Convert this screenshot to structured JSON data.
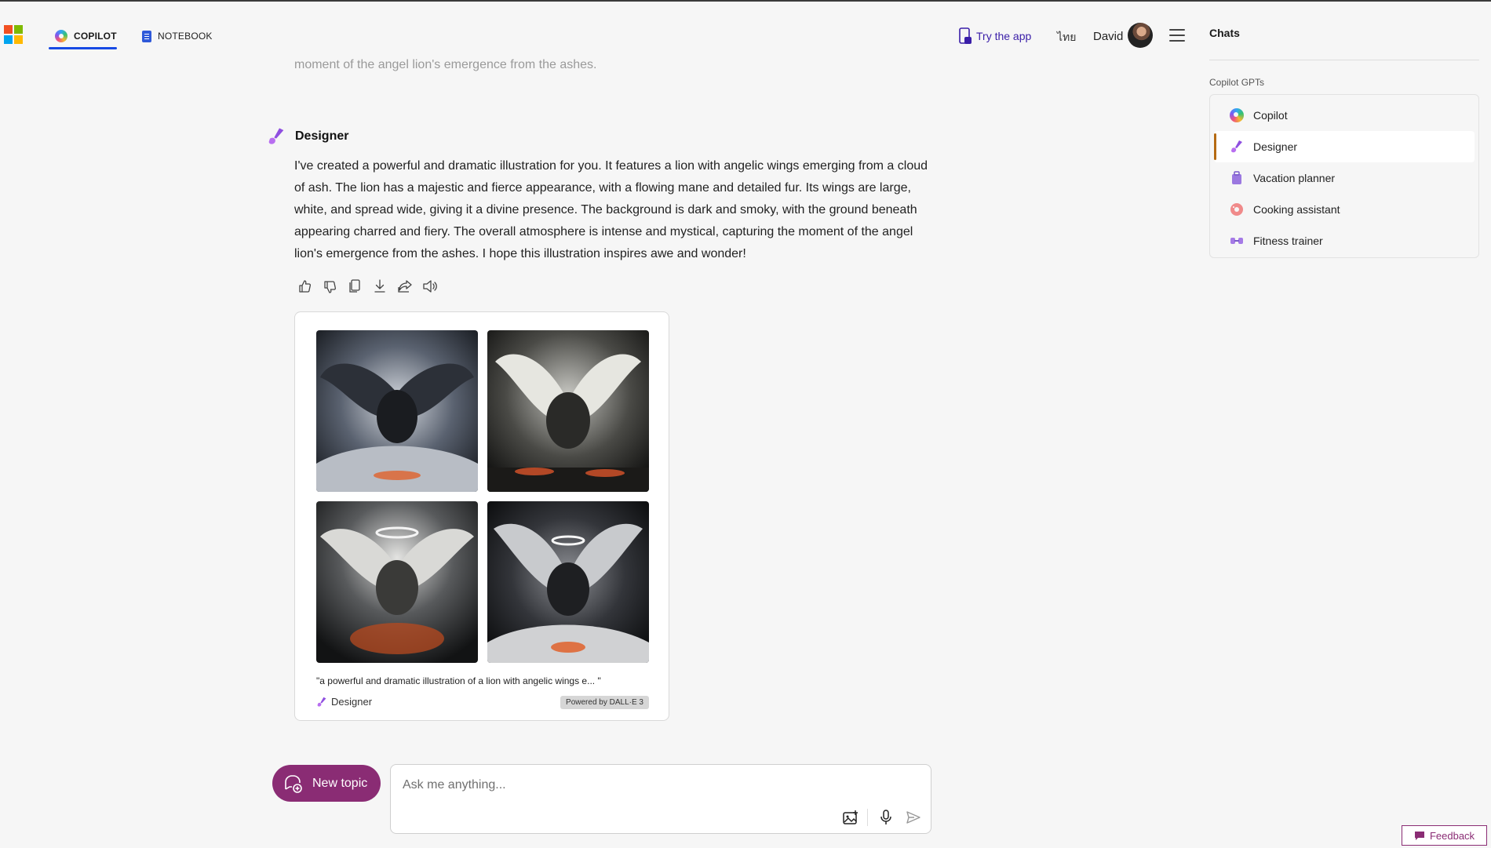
{
  "header": {
    "tabs": [
      {
        "label": "COPILOT",
        "active": true
      },
      {
        "label": "NOTEBOOK",
        "active": false
      }
    ],
    "try_app": "Try the app",
    "language": "ไทย",
    "user_name": "David"
  },
  "sidebar": {
    "title": "Chats",
    "section_label": "Copilot GPTs",
    "items": [
      {
        "label": "Copilot",
        "icon": "copilot-icon",
        "active": false
      },
      {
        "label": "Designer",
        "icon": "designer-icon",
        "active": true
      },
      {
        "label": "Vacation planner",
        "icon": "suitcase-icon",
        "active": false
      },
      {
        "label": "Cooking assistant",
        "icon": "donut-icon",
        "active": false
      },
      {
        "label": "Fitness trainer",
        "icon": "dumbbell-icon",
        "active": false
      }
    ]
  },
  "conversation": {
    "previous_text": "moment of the angel lion's emergence from the ashes.",
    "assistant_name": "Designer",
    "response": "I've created a powerful and dramatic illustration for you. It features a lion with angelic wings emerging from a cloud of ash. The lion has a majestic and fierce appearance, with a flowing mane and detailed fur. Its wings are large, white, and spread wide, giving it a divine presence. The background is dark and smoky, with the ground beneath appearing charred and fiery. The overall atmosphere is intense and mystical, capturing the moment of the angel lion's emergence from the ashes. I hope this illustration inspires awe and wonder!",
    "actions": [
      "thumbs-up-icon",
      "thumbs-down-icon",
      "copy-icon",
      "download-icon",
      "share-icon",
      "speaker-icon"
    ],
    "image_card": {
      "prompt": "\"a powerful and dramatic illustration of a lion with angelic wings e...  \"",
      "source": "Designer",
      "powered_by": "Powered by DALL·E 3",
      "image_count": 4
    }
  },
  "composer": {
    "new_topic": "New topic",
    "placeholder": "Ask me anything..."
  },
  "feedback": "Feedback",
  "colors": {
    "accent_blue": "#174ae4",
    "brand_purple": "#8a2c74",
    "active_marker": "#b56a12"
  }
}
